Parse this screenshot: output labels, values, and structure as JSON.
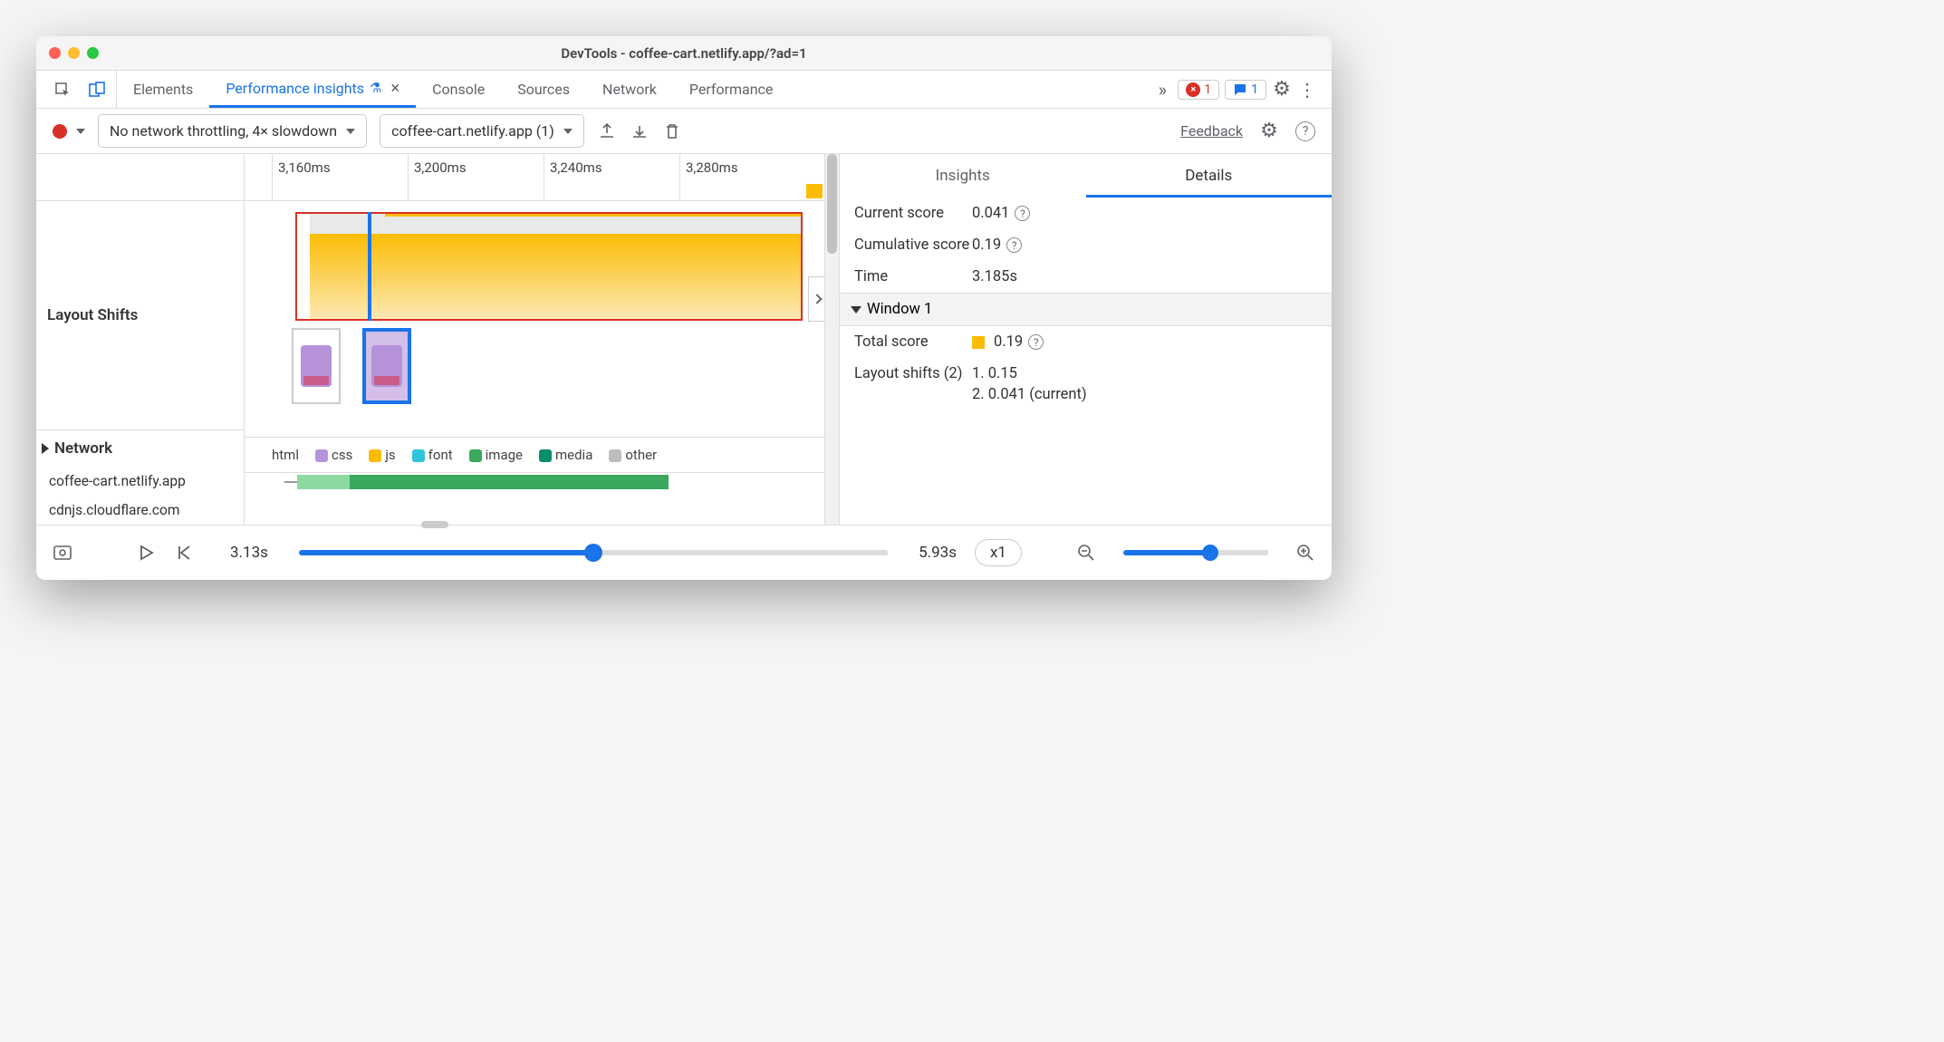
{
  "window_title": "DevTools - coffee-cart.netlify.app/?ad=1",
  "tabs": {
    "elements": "Elements",
    "perf_insights": "Performance insights",
    "console": "Console",
    "sources": "Sources",
    "network": "Network",
    "performance": "Performance"
  },
  "badges": {
    "errors": "1",
    "messages": "1"
  },
  "toolbar": {
    "throttle": "No network throttling, 4× slowdown",
    "recording": "coffee-cart.netlify.app (1)",
    "feedback": "Feedback"
  },
  "timeline": {
    "ticks": [
      "3,160ms",
      "3,200ms",
      "3,240ms",
      "3,280ms"
    ],
    "layout_shifts_label": "Layout Shifts",
    "network_label": "Network",
    "hosts": [
      "coffee-cart.netlify.app",
      "cdnjs.cloudflare.com"
    ],
    "legend": {
      "html": "html",
      "css": "css",
      "js": "js",
      "font": "font",
      "image": "image",
      "media": "media",
      "other": "other"
    }
  },
  "legend_colors": {
    "html": "#4a90e2",
    "css": "#b693d9",
    "js": "#fbbc04",
    "font": "#2ec4d9",
    "image": "#3aa85d",
    "media": "#0a8f6c",
    "other": "#bdbdbd"
  },
  "details": {
    "tabs": {
      "insights": "Insights",
      "details": "Details"
    },
    "current_score_label": "Current score",
    "current_score": "0.041",
    "cum_score_label": "Cumulative score",
    "cum_score": "0.19",
    "time_label": "Time",
    "time": "3.185s",
    "window_header": "Window 1",
    "total_score_label": "Total score",
    "total_score": "0.19",
    "shifts_label": "Layout shifts (2)",
    "shift1": "1. 0.15",
    "shift2": "2. 0.041 (current)"
  },
  "footer": {
    "start_time": "3.13s",
    "end_time": "5.93s",
    "speed": "x1"
  }
}
